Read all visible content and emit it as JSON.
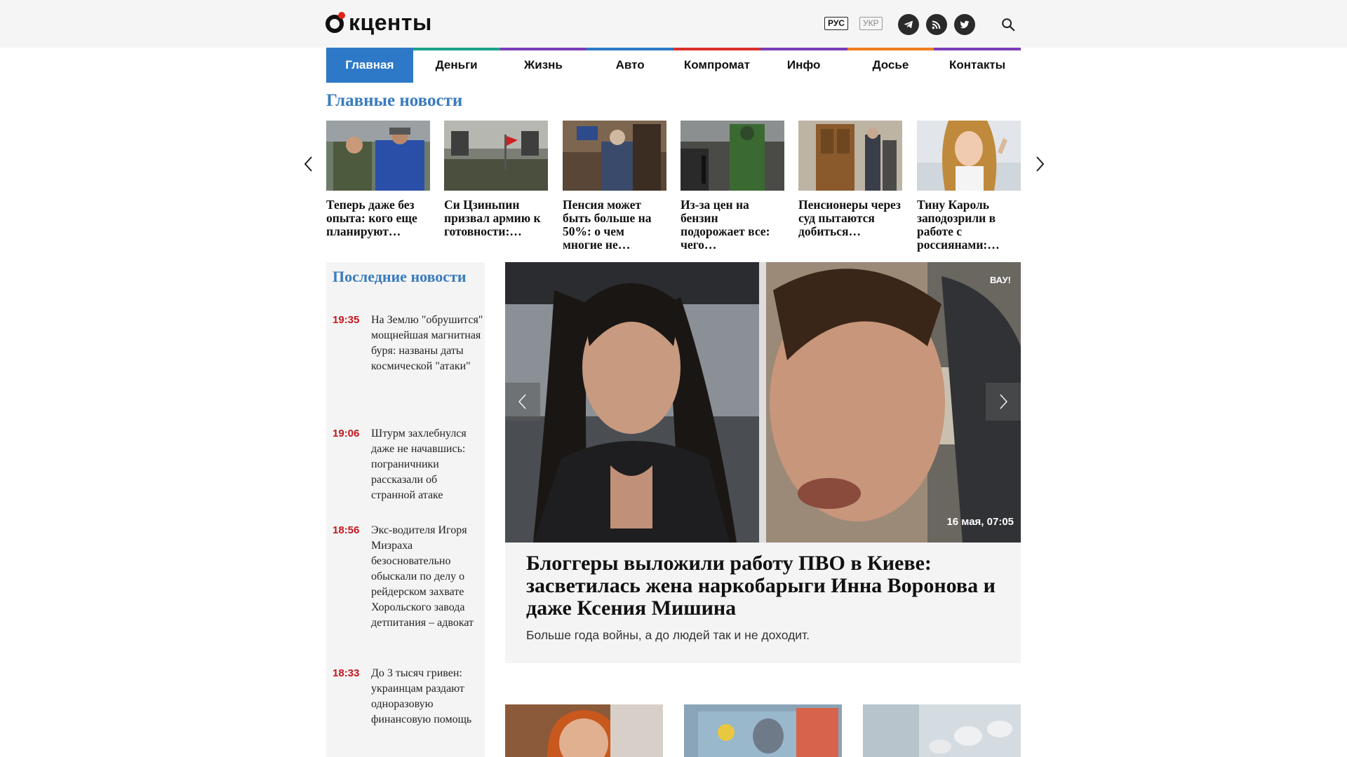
{
  "header": {
    "logo_text": "кценты",
    "lang_ru": "РУС",
    "lang_uk": "УКР",
    "social": [
      "telegram-icon",
      "rss-icon",
      "twitter-icon"
    ],
    "search_icon": "search-icon"
  },
  "nav": {
    "items": [
      {
        "label": "Главная",
        "color": "#2d79c7",
        "active": true
      },
      {
        "label": "Деньги",
        "color": "#1aa38a"
      },
      {
        "label": "Жизнь",
        "color": "#7a3db8"
      },
      {
        "label": "Авто",
        "color": "#2d79c7"
      },
      {
        "label": "Компромат",
        "color": "#d9312a"
      },
      {
        "label": "Инфо",
        "color": "#7a3db8"
      },
      {
        "label": "Досье",
        "color": "#f07e1f"
      },
      {
        "label": "Контакты",
        "color": "#7a3db8"
      }
    ]
  },
  "top_news": {
    "title": "Главные новости",
    "items": [
      {
        "title": "Теперь даже без опыта: кого еще планируют…"
      },
      {
        "title": "Си Цзиньпин призвал армию к готовности:…"
      },
      {
        "title": "Пенсия может быть больше на 50%: о чем многие не…"
      },
      {
        "title": "Из-за цен на бензин подорожает все: чего…"
      },
      {
        "title": "Пенсионеры через суд пытаются добиться…"
      },
      {
        "title": "Тину Кароль заподозрили в работе с россиянами:…"
      }
    ]
  },
  "latest": {
    "title": "Последние новости",
    "items": [
      {
        "time": "19:35",
        "text": "На Землю \"обрушится\" мощнейшая магнитная буря: названы даты космической \"атаки\""
      },
      {
        "time": "19:06",
        "text": "Штурм захлебнулся даже не начавшись: пограничники рассказали об странной атаке"
      },
      {
        "time": "18:56",
        "text": "Экс-водителя Игоря Мизраха безосновательно обыскали по делу о рейдерском захвате Хорольского завода детпитания – адвокат"
      },
      {
        "time": "18:33",
        "text": "До 3 тысяч гривен: украинцам раздают одноразовую финансовую помощь"
      }
    ]
  },
  "featured": {
    "badge": "ВАУ!",
    "date": "16 мая, 07:05",
    "title": "Блоггеры выложили работу ПВО в Киеве: засветилась жена наркобарыги Инна Воронова и даже Ксения Мишина",
    "subtitle": "Больше года войны, а до людей так и не доходит."
  }
}
